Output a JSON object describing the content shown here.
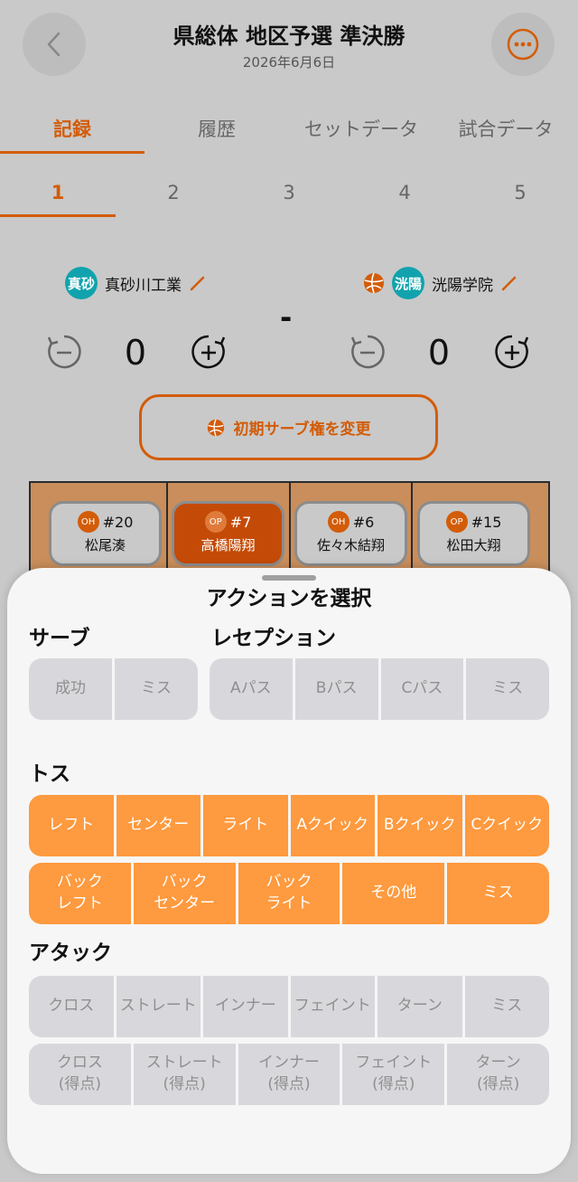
{
  "header": {
    "title": "県総体 地区予選 準決勝",
    "date": "2026年6月6日"
  },
  "tabs": [
    {
      "label": "記録",
      "active": true
    },
    {
      "label": "履歴",
      "active": false
    },
    {
      "label": "セットデータ",
      "active": false
    },
    {
      "label": "試合データ",
      "active": false
    }
  ],
  "sets": [
    {
      "label": "1",
      "active": true
    },
    {
      "label": "2",
      "active": false
    },
    {
      "label": "3",
      "active": false
    },
    {
      "label": "4",
      "active": false
    },
    {
      "label": "5",
      "active": false
    }
  ],
  "teams": {
    "home": {
      "badge": "真砂",
      "name": "真砂川工業",
      "score": "0"
    },
    "away": {
      "badge": "洸陽",
      "name": "洸陽学院",
      "score": "0"
    },
    "separator": "-"
  },
  "serve_button": {
    "label": "初期サーブ権を変更"
  },
  "court": {
    "players": [
      {
        "position": "OH",
        "number": "#20",
        "name": "松尾湊",
        "selected": false
      },
      {
        "position": "OP",
        "number": "#7",
        "name": "高橋陽翔",
        "selected": true
      },
      {
        "position": "OH",
        "number": "#6",
        "name": "佐々木結翔",
        "selected": false
      },
      {
        "position": "OP",
        "number": "#15",
        "name": "松田大翔",
        "selected": false
      }
    ]
  },
  "action_sheet": {
    "title": "アクションを選択",
    "serve": {
      "label": "サーブ",
      "buttons": [
        "成功",
        "ミス"
      ]
    },
    "reception": {
      "label": "レセプション",
      "buttons": [
        "Aパス",
        "Bパス",
        "Cパス",
        "ミス"
      ]
    },
    "toss": {
      "label": "トス",
      "row1": [
        "レフト",
        "センター",
        "ライト",
        "Aクイック",
        "Bクイック",
        "Cクイック"
      ],
      "row2": [
        {
          "line1": "バック",
          "line2": "レフト"
        },
        {
          "line1": "バック",
          "line2": "センター"
        },
        {
          "line1": "バック",
          "line2": "ライト"
        },
        {
          "line1": "その他",
          "line2": ""
        },
        {
          "line1": "ミス",
          "line2": ""
        }
      ]
    },
    "attack": {
      "label": "アタック",
      "row1": [
        "クロス",
        "ストレート",
        "インナー",
        "フェイント",
        "ターン",
        "ミス"
      ],
      "row2": [
        {
          "line1": "クロス",
          "line2": "(得点)"
        },
        {
          "line1": "ストレート",
          "line2": "(得点)"
        },
        {
          "line1": "インナー",
          "line2": "(得点)"
        },
        {
          "line1": "フェイント",
          "line2": "(得点)"
        },
        {
          "line1": "ターン",
          "line2": "(得点)"
        }
      ]
    }
  },
  "colors": {
    "accent": "#d35c08",
    "toss_button": "#fe9a3f",
    "team_badge": "#11a3ad"
  }
}
